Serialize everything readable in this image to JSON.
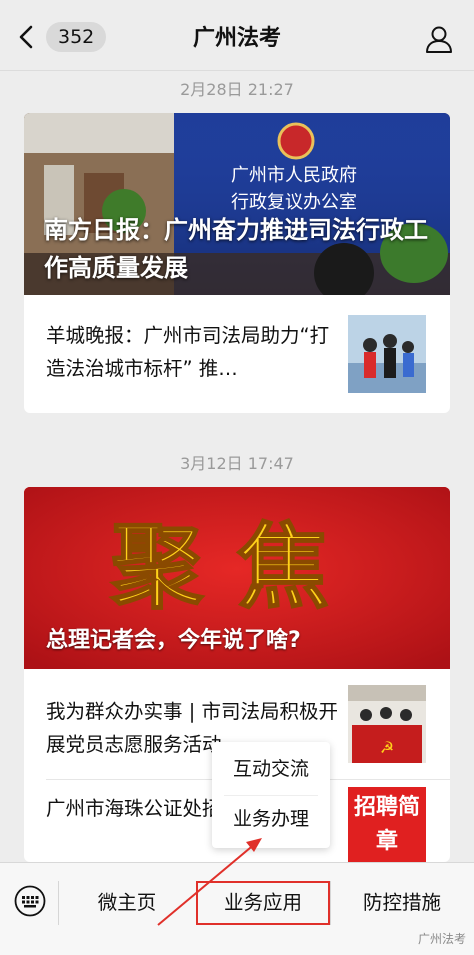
{
  "header": {
    "unread_count": "352",
    "title": "广州法考"
  },
  "messages": [
    {
      "timestamp": "2月28日 21:27",
      "hero": {
        "banner_line1": "广州市人民政府",
        "banner_line2": "行政复议办公室",
        "title": "南方日报：广州奋力推进司法行政工作高质量发展"
      },
      "items": [
        {
          "text": "羊城晚报：广州市司法局助力“打造法治城市标杆” 推…"
        }
      ]
    },
    {
      "timestamp": "3月12日 17:47",
      "hero": {
        "big_text": "聚焦",
        "title": "总理记者会，今年说了啥?"
      },
      "items": [
        {
          "text": "我为群众办实事 | 市司法局积极开展党员志愿服务活动"
        },
        {
          "text": "广州市海珠公证处招聘简章",
          "thumb_text": "招聘简章"
        }
      ]
    }
  ],
  "popup_menu": {
    "items": [
      "互动交流",
      "业务办理"
    ]
  },
  "bottom_menu": {
    "items": [
      "微主页",
      "业务应用",
      "防控措施"
    ]
  },
  "watermark": "广州法考",
  "colors": {
    "accent_red": "#e0302a",
    "banner_blue": "#1f3d9a",
    "poster_red": "#d0181d"
  }
}
